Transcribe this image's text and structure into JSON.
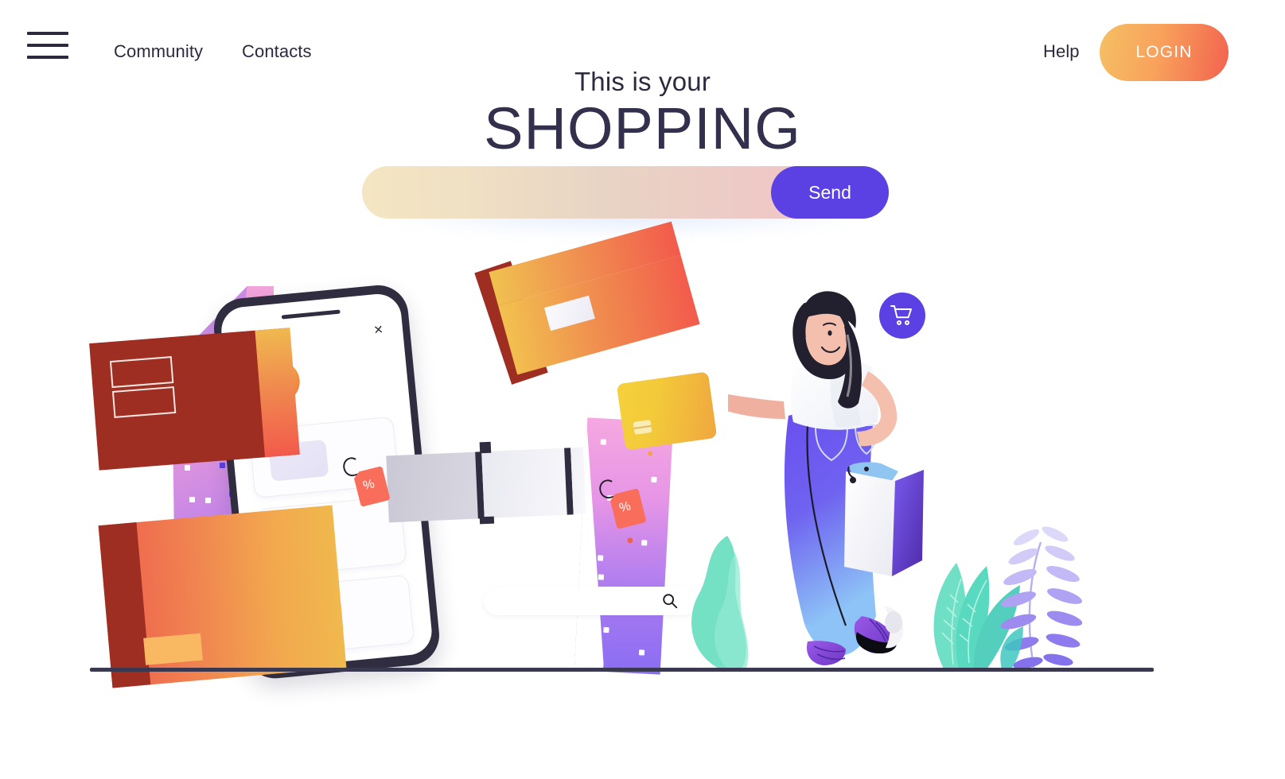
{
  "header": {
    "menu_icon": "hamburger-menu-icon",
    "nav": [
      {
        "label": "Community"
      },
      {
        "label": "Contacts"
      }
    ],
    "help_label": "Help",
    "login_label": "LOGIN"
  },
  "hero": {
    "kicker": "This is your",
    "title": "SHOPPING"
  },
  "search": {
    "value": "",
    "placeholder": "",
    "send_label": "Send"
  },
  "illustration": {
    "phone": {
      "menu_icon": "hamburger-menu-icon",
      "close_icon": "close-icon",
      "avatar": "user-avatar-icon",
      "cards": 3
    },
    "search_pill": {
      "value": "",
      "icon": "search-icon"
    },
    "cart_badge_icon": "shopping-cart-icon",
    "price_tags": [
      {
        "symbol": "%"
      },
      {
        "symbol": "%"
      }
    ]
  },
  "colors": {
    "brand_purple": "#5b40e3",
    "login_gradient_from": "#f5c063",
    "login_gradient_to": "#f2624e",
    "heading": "#32304d",
    "nav_text": "#2b2a3f",
    "search_from": "#f4e6c2",
    "search_to": "#efc5c5",
    "box_orange_from": "#f0c24f",
    "box_orange_to": "#f25a4c",
    "box_maroon": "#9e2d22",
    "tag_red": "#f96d5b",
    "mint": "#6bdcc0",
    "ground": "#3a3850"
  }
}
